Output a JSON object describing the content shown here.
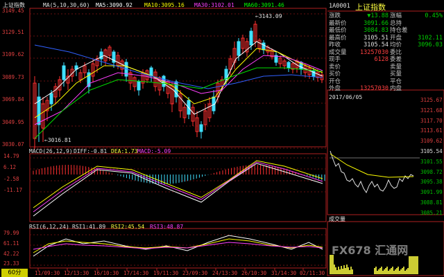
{
  "main_chart": {
    "title": "上证指数",
    "ma_params": "MA(5,10,30,60)",
    "ma5": {
      "label": "MA5:",
      "value": "3090.92",
      "color": "#ffffff"
    },
    "ma10": {
      "label": "MA10:",
      "value": "3095.16",
      "color": "#ffff00"
    },
    "ma30": {
      "label": "MA30:",
      "value": "3102.01",
      "color": "#ff40ff"
    },
    "ma60": {
      "label": "MA60:",
      "value": "3091.46",
      "color": "#00ff00"
    },
    "price_axis": [
      "3149.45",
      "3129.51",
      "3109.62",
      "3089.73",
      "3069.84",
      "3049.95",
      "3030.07"
    ],
    "high_annotation": "3143.09",
    "low_annotation": "3016.81"
  },
  "macd": {
    "params": "MACD(26,12,9)",
    "diff": {
      "label": "DIFF:",
      "value": "-0.81"
    },
    "dea": {
      "label": "DEA:",
      "value": "1.73"
    },
    "macd": {
      "label": "MACD:",
      "value": "-5.09"
    },
    "axis": [
      "14.79",
      "6.12",
      "-2.58",
      "-11.17"
    ]
  },
  "rsi": {
    "params": "RSI(6,12,24)",
    "rsi1": {
      "label": "RSI1:",
      "value": "41.89"
    },
    "rsi2": {
      "label": "RSI2:",
      "value": "45.54"
    },
    "rsi3": {
      "label": "RSI3:",
      "value": "48.87"
    },
    "axis": [
      "79.99",
      "61.11",
      "42.22",
      "23.33"
    ]
  },
  "date_axis": [
    "11/09:30",
    "12/13:30",
    "16/10:30",
    "17/14:30",
    "19/11:30",
    "23/09:30",
    "24/13:30",
    "26/10:30",
    "31/14:30",
    "02/11:30"
  ],
  "period_badge": "60分",
  "right_panel": {
    "code": "1A0001",
    "name": "上证指数",
    "rows": [
      {
        "l1": "涨跌",
        "v1": "▼13.88",
        "c1": "green",
        "l2": "涨幅",
        "v2": "0.45%",
        "c2": "green"
      },
      {
        "l1": "最新价",
        "v1": "3091.66",
        "c1": "green",
        "l2": "总持",
        "v2": "",
        "c2": "white"
      },
      {
        "l1": "最低价",
        "v1": "3084.83",
        "c1": "green",
        "l2": "持仓差",
        "v2": "",
        "c2": "white"
      },
      {
        "l1": "最高价",
        "v1": "3105.51",
        "c1": "white",
        "l2": "开盘",
        "v2": "3102.11",
        "c2": "green"
      },
      {
        "l1": "昨收",
        "v1": "3105.54",
        "c1": "white",
        "l2": "均价",
        "v2": "3096.03",
        "c2": "green"
      },
      {
        "l1": "成交量",
        "v1": "13257030",
        "c1": "red",
        "l2": "委比",
        "v2": "",
        "c2": "white"
      },
      {
        "l1": "现手",
        "v1": "6128",
        "c1": "red",
        "l2": "委差",
        "v2": "",
        "c2": "white"
      },
      {
        "l1": "卖价",
        "v1": "",
        "c1": "white",
        "l2": "卖量",
        "v2": "",
        "c2": "white"
      },
      {
        "l1": "买价",
        "v1": "",
        "c1": "white",
        "l2": "买量",
        "v2": "",
        "c2": "white"
      },
      {
        "l1": "开仓",
        "v1": "",
        "c1": "white",
        "l2": "平仓",
        "v2": "",
        "c2": "white"
      },
      {
        "l1": "外盘",
        "v1": "13257030",
        "c1": "red",
        "l2": "内盘",
        "v2": "",
        "c2": "white"
      }
    ],
    "mini_date": "2017/06/05",
    "mini_axis": [
      "3125.67",
      "3121.68",
      "3117.70",
      "3113.61",
      "3109.62",
      "3105.54",
      "3101.55",
      "3098.72",
      "3095.38",
      "3091.99",
      "3088.81",
      "3085.21"
    ],
    "volume_label": "成交量"
  },
  "watermark": "FX678 汇通网"
}
